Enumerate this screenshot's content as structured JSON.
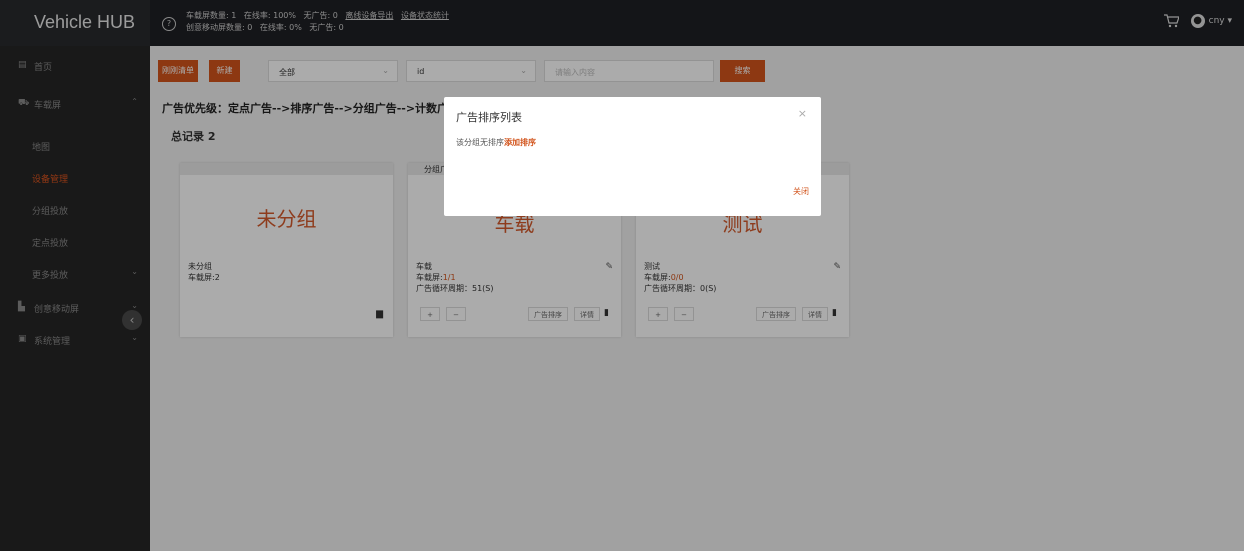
{
  "header": {
    "logo": "Vehicle HUB",
    "help_icon": "?",
    "stats_row1": {
      "vehicle_count": "车载屏数量: 1",
      "online_rate": "在线率: 100%",
      "no_ad": "无广告: 0",
      "export_link": "离线设备导出",
      "stats_link": "设备状态统计"
    },
    "stats_row2": {
      "mobile_count": "创意移动屏数量: 0",
      "online_rate": "在线率: 0%",
      "no_ad": "无广告: 0"
    },
    "user": "cny ▾",
    "cart_icon": "cart-icon",
    "user_icon": "user-icon"
  },
  "sidebar": {
    "home": "首页",
    "vehicle_screen": "车载屏",
    "map": "地图",
    "device_mgmt": "设备管理",
    "group_delivery": "分组投放",
    "fixed_delivery": "定点投放",
    "more_delivery": "更多投放",
    "creative_mobile": "创意移动屏",
    "system_mgmt": "系统管理",
    "collapse": "‹"
  },
  "toolbar": {
    "list_btn": "刚刚清单",
    "new_btn": "新建",
    "select1": "全部",
    "select2": "id",
    "search_placeholder": "请输入内容",
    "search_btn": "搜索"
  },
  "priority_text": "广告优先级：定点广告-->排序广告-->分组广告-->计数广告",
  "total_text": "总记录 2",
  "cards": [
    {
      "head": "",
      "title": "未分组",
      "line1": "未分组",
      "line2": "车载屏:2",
      "line3": "",
      "line3_value": ""
    },
    {
      "head": "分组广",
      "title": "车载",
      "line1": "车载",
      "line2_label": "车载屏:",
      "line2_value": "1/1",
      "line3": "广告循环周期：51(S)",
      "plus": "+",
      "minus": "−",
      "sort_btn": "广告排序",
      "detail_btn": "详情"
    },
    {
      "head": "无",
      "title": "测试",
      "line1": "测试",
      "line2_label": "车载屏:",
      "line2_value": "0/0",
      "line3": "广告循环周期：0(S)",
      "plus": "+",
      "minus": "−",
      "sort_btn": "广告排序",
      "detail_btn": "详情"
    }
  ],
  "modal": {
    "title": "广告排序列表",
    "close": "×",
    "body_text": "该分组无排序",
    "body_link": "添加排序",
    "confirm": "关闭"
  },
  "colors": {
    "accent": "#d2541c",
    "sidebar_bg": "#262626",
    "header_bg": "#1f2024"
  }
}
